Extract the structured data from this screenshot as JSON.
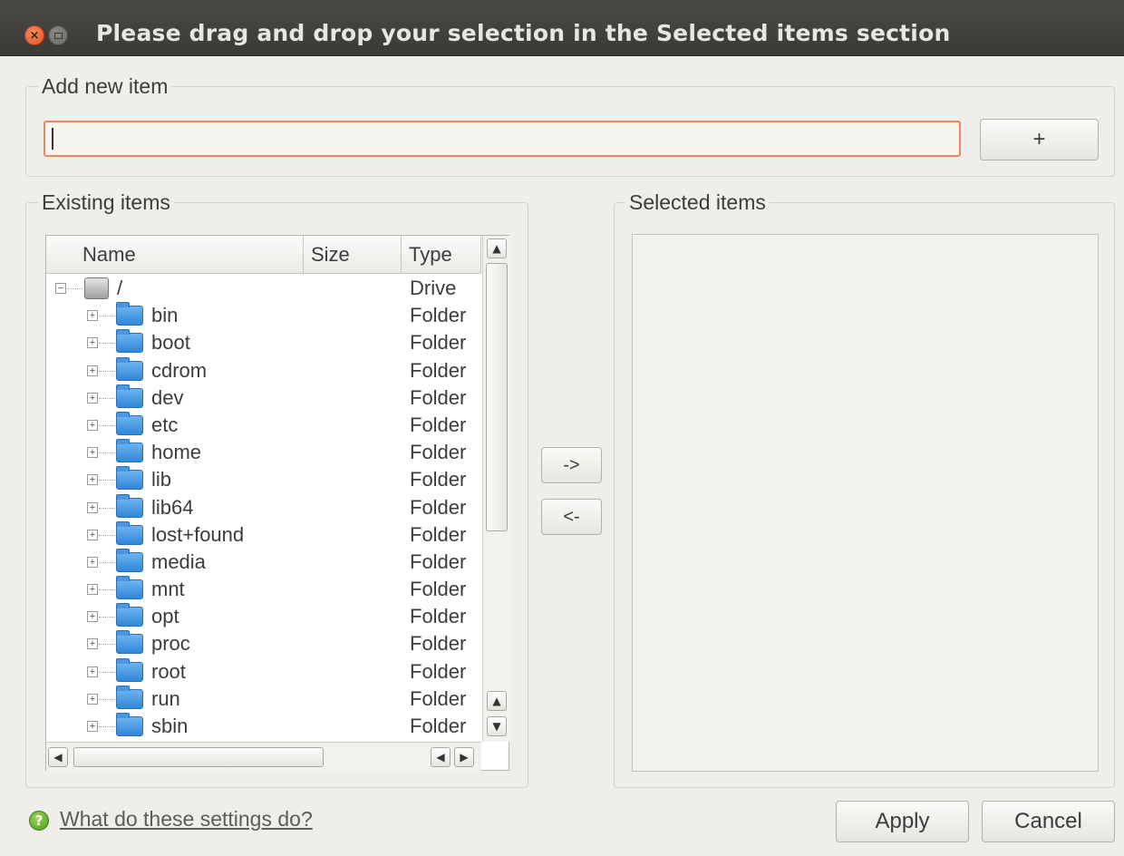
{
  "window": {
    "title": "Please drag and drop your selection in the Selected items section"
  },
  "add_new": {
    "group_title": "Add new item",
    "input_value": "",
    "add_button_label": "+"
  },
  "existing": {
    "group_title": "Existing items",
    "columns": {
      "name": "Name",
      "size": "Size",
      "type": "Type"
    },
    "root": {
      "name": "/",
      "type": "Drive"
    },
    "rows": [
      {
        "name": "bin",
        "type": "Folder"
      },
      {
        "name": "boot",
        "type": "Folder"
      },
      {
        "name": "cdrom",
        "type": "Folder"
      },
      {
        "name": "dev",
        "type": "Folder"
      },
      {
        "name": "etc",
        "type": "Folder"
      },
      {
        "name": "home",
        "type": "Folder"
      },
      {
        "name": "lib",
        "type": "Folder"
      },
      {
        "name": "lib64",
        "type": "Folder"
      },
      {
        "name": "lost+found",
        "type": "Folder"
      },
      {
        "name": "media",
        "type": "Folder"
      },
      {
        "name": "mnt",
        "type": "Folder"
      },
      {
        "name": "opt",
        "type": "Folder"
      },
      {
        "name": "proc",
        "type": "Folder"
      },
      {
        "name": "root",
        "type": "Folder"
      },
      {
        "name": "run",
        "type": "Folder"
      },
      {
        "name": "sbin",
        "type": "Folder"
      }
    ]
  },
  "transfer": {
    "add_label": "->",
    "remove_label": "<-"
  },
  "selected": {
    "group_title": "Selected items"
  },
  "footer": {
    "help_link": "What do these settings do?",
    "apply_label": "Apply",
    "cancel_label": "Cancel"
  },
  "colors": {
    "accent_focus": "#e9875d",
    "titlebar": "#3b3a37",
    "folder": "#2f86d8",
    "help_icon": "#4f9a1c"
  }
}
